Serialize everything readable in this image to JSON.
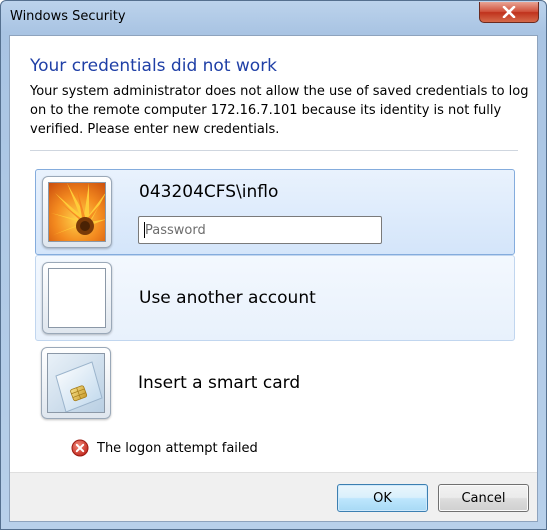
{
  "window": {
    "title": "Windows Security"
  },
  "dialog": {
    "heading": "Your credentials did not work",
    "message": "Your system administrator does not allow the use of saved credentials to log on to the remote computer 172.16.7.101 because its identity is not fully verified. Please enter new credentials."
  },
  "tiles": {
    "current_user": {
      "name": "043204CFS\\inflo",
      "password_placeholder": "Password",
      "password_value": ""
    },
    "other_account": {
      "label": "Use another account"
    },
    "smart_card": {
      "label": "Insert a smart card"
    }
  },
  "status": {
    "error_text": "The logon attempt failed",
    "error_icon": "error-x-icon"
  },
  "buttons": {
    "ok": "OK",
    "cancel": "Cancel"
  },
  "colors": {
    "heading": "#1f3fa6",
    "close_button": "#c7402a",
    "selection_border": "#84acdd"
  }
}
